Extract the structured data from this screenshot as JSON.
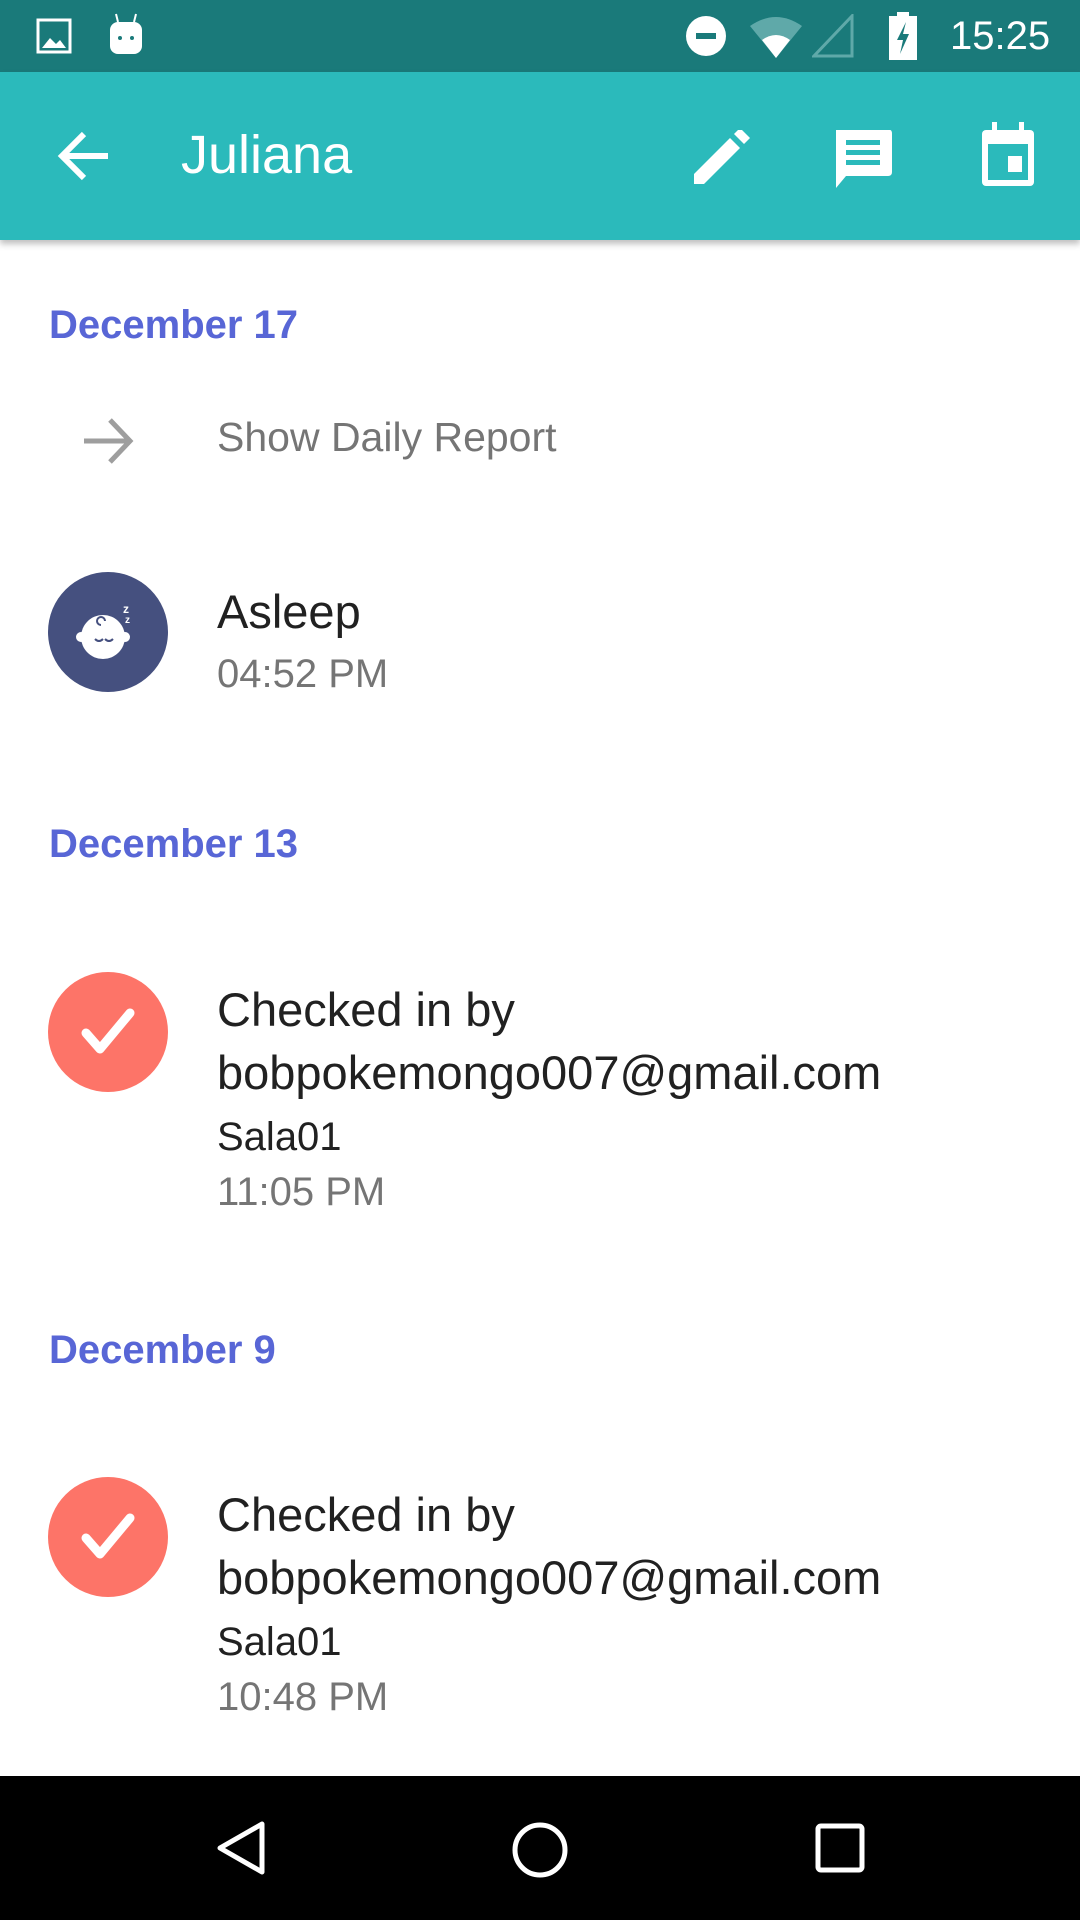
{
  "status_bar": {
    "time": "15:25",
    "icons": [
      "image-icon",
      "android-icon",
      "do-not-disturb-icon",
      "wifi-icon",
      "signal-icon",
      "battery-charging-icon"
    ]
  },
  "app_bar": {
    "title": "Juliana",
    "actions": [
      "edit-icon",
      "message-icon",
      "calendar-icon"
    ]
  },
  "colors": {
    "primary": "#2bbabb",
    "primary_dark": "#1a7a7a",
    "section_header": "#5866d6",
    "asleep": "#45507f",
    "checkin": "#fd7468"
  },
  "sections": [
    {
      "date": "December 17",
      "link": "Show Daily Report",
      "entries": [
        {
          "title": "Asleep",
          "time": "04:52 PM"
        }
      ]
    },
    {
      "date": "December 13",
      "entries": [
        {
          "title_line1": "Checked in by",
          "title_line2": "bobpokemongo007@gmail.com",
          "room": "Sala01",
          "time": "11:05 PM"
        }
      ]
    },
    {
      "date": "December 9",
      "entries": [
        {
          "title_line1": "Checked in by",
          "title_line2": "bobpokemongo007@gmail.com",
          "room": "Sala01",
          "time": "10:48 PM"
        }
      ]
    }
  ]
}
